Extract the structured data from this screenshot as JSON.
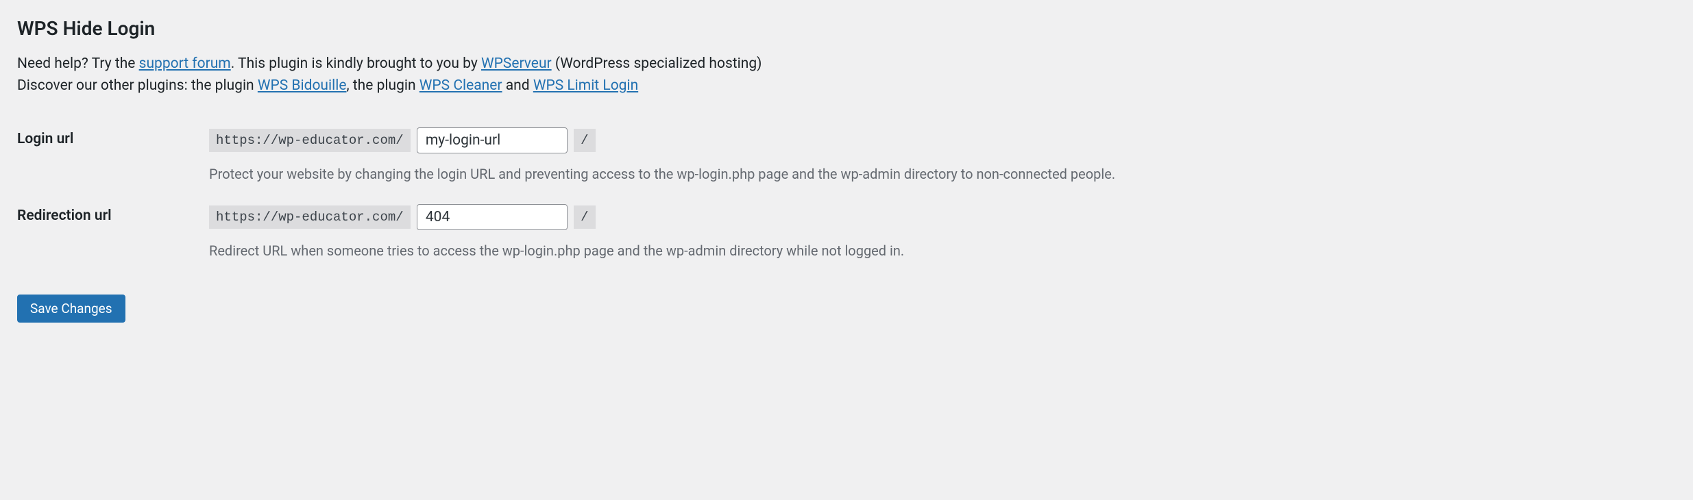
{
  "section": {
    "title": "WPS Hide Login"
  },
  "intro": {
    "help_prefix": "Need help? Try the ",
    "support_link": "support forum",
    "brought_prefix": ". This plugin is kindly brought to you by ",
    "wpserveur_link": "WPServeur",
    "brought_suffix": " (WordPress specialized hosting)",
    "discover_prefix": "Discover our other plugins: the plugin ",
    "bidouille_link": "WPS Bidouille",
    "sep1": ", the plugin ",
    "cleaner_link": "WPS Cleaner",
    "sep2": " and ",
    "limit_link": "WPS Limit Login"
  },
  "fields": {
    "login": {
      "label": "Login url",
      "prefix": "https://wp-educator.com/",
      "value": "my-login-url",
      "suffix": "/",
      "description": "Protect your website by changing the login URL and preventing access to the wp-login.php page and the wp-admin directory to non-connected people."
    },
    "redirect": {
      "label": "Redirection url",
      "prefix": "https://wp-educator.com/",
      "value": "404",
      "suffix": "/",
      "description": "Redirect URL when someone tries to access the wp-login.php page and the wp-admin directory while not logged in."
    }
  },
  "submit": {
    "label": "Save Changes"
  }
}
